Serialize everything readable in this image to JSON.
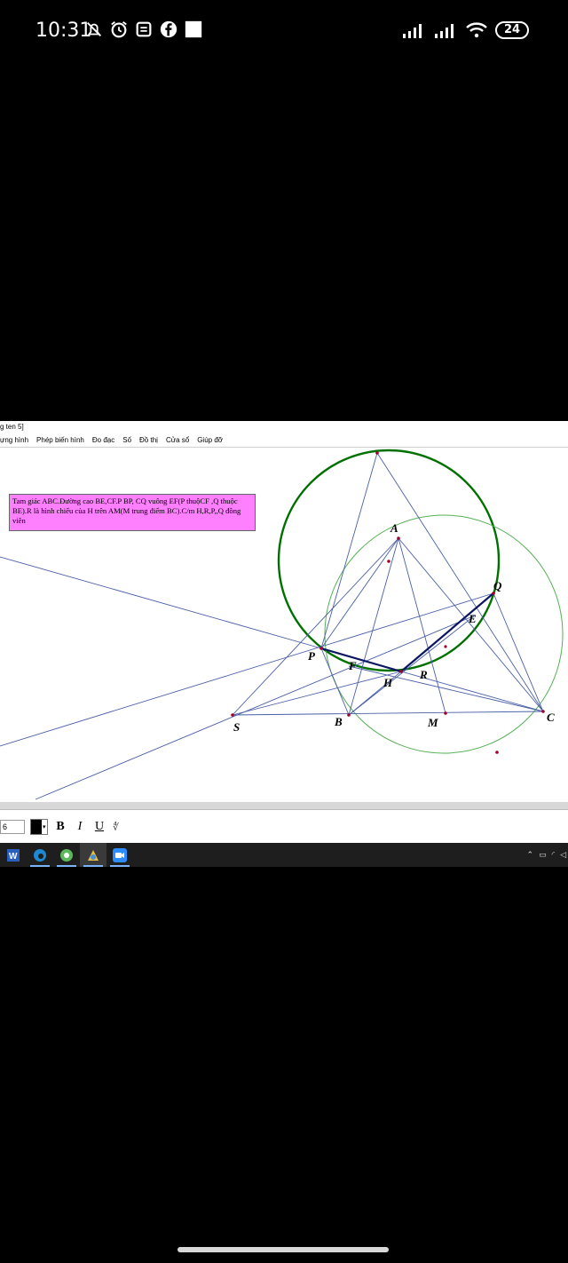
{
  "status_bar": {
    "time": "10:31",
    "battery": "24",
    "icons": [
      "alarm-off-icon",
      "alarm-clock-icon",
      "notes-icon",
      "facebook-icon",
      "square-icon"
    ],
    "right_icons": [
      "signal-icon",
      "signal-icon",
      "wifi-icon",
      "battery-icon"
    ]
  },
  "app": {
    "title": "g ten 5]",
    "menu": [
      "ựng hình",
      "Phép biến hình",
      "Đo đạc",
      "Số",
      "Đồ thị",
      "Cửa sổ",
      "Giúp đỡ"
    ]
  },
  "note": {
    "text": "Tam giác ABC.Đường cao BE,CF.P BP, CQ vuông EF(P thuộCF ,Q thuộc BE).R là hình chiếu của H trên AM(M trung điểm BC).C/m H,R,P,,Q đồng viên"
  },
  "points": {
    "A": "A",
    "P": "P",
    "Q": "Q",
    "E": "E",
    "F": "F",
    "H": "H",
    "R": "R",
    "S": "S",
    "B": "B",
    "M": "M",
    "C": "C"
  },
  "format_bar": {
    "font_size": "6",
    "bold": "B",
    "italic": "I",
    "underline": "U",
    "text_color": "#000000"
  },
  "taskbar": {
    "apps": [
      "word-icon",
      "edge-icon",
      "green-app-icon",
      "sketchpad-icon",
      "zoom-icon"
    ]
  },
  "colors": {
    "thin_line": "#4a5fa8",
    "thick_line": "#0a1660",
    "big_circle": "#007000",
    "small_circle": "#55b055",
    "note_bg": "#ff80ff",
    "point": "#a0002a"
  }
}
